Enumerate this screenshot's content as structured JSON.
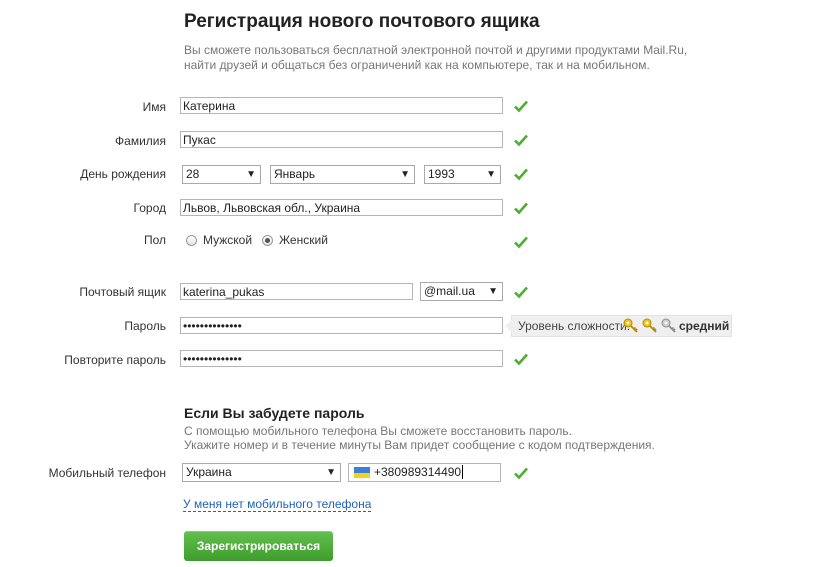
{
  "header": {
    "title": "Регистрация нового почтового ящика",
    "intro_line1": "Вы сможете пользоваться бесплатной электронной почтой и другими продуктами Mail.Ru,",
    "intro_line2": "найти друзей и общаться без ограничений как на компьютере, так и на мобильном."
  },
  "form": {
    "first_name": {
      "label": "Имя",
      "value": "Катерина"
    },
    "last_name": {
      "label": "Фамилия",
      "value": "Пукас"
    },
    "birthday": {
      "label": "День рождения",
      "day": "28",
      "month": "Январь",
      "year": "1993"
    },
    "city": {
      "label": "Город",
      "value": "Львов, Львовская обл., Украина"
    },
    "gender": {
      "label": "Пол",
      "male": "Мужской",
      "female": "Женский",
      "selected": "female"
    },
    "mailbox": {
      "label": "Почтовый ящик",
      "value": "katerina_pukas",
      "domain": "@mail.ua"
    },
    "password": {
      "label": "Пароль",
      "value": "••••••••••••••",
      "strength_label": "Уровень сложности:",
      "strength_level": "средний",
      "keys_filled": 2,
      "keys_total": 3
    },
    "password_repeat": {
      "label": "Повторите пароль",
      "value": "••••••••••••••"
    }
  },
  "recovery": {
    "title": "Если Вы забудете пароль",
    "hint_line1": "С помощью мобильного телефона Вы сможете восстановить пароль.",
    "hint_line2": "Укажите номер и в течение минуты Вам придет сообщение с кодом подтверждения.",
    "phone_label": "Мобильный телефон",
    "country": "Украина",
    "phone": "+380989314490",
    "no_phone_link": "У меня нет мобильного телефона"
  },
  "submit_label": "Зарегистрироваться",
  "colors": {
    "check": "#4caf2f",
    "button": "#4cae38",
    "link": "#1d63b8",
    "flag_top": "#3d7fd6",
    "flag_bottom": "#f7d117"
  },
  "icons": {
    "valid": "check-icon",
    "strength": "key-icon",
    "dropdown": "chevron-down-icon",
    "country_flag": "ukraine-flag-icon"
  }
}
